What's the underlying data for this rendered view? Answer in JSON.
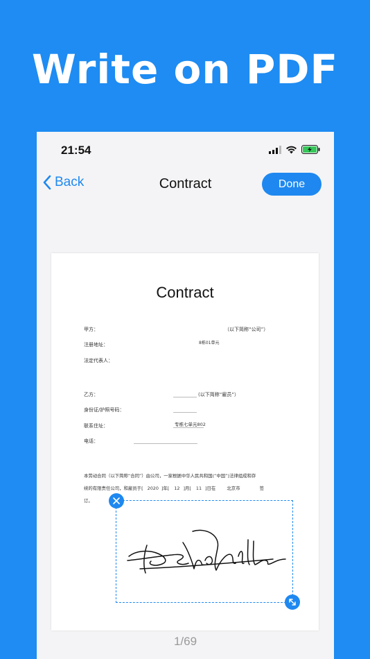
{
  "headline": "Write on PDF",
  "status": {
    "time": "21:54"
  },
  "nav": {
    "back_label": "Back",
    "title": "Contract",
    "done_label": "Done"
  },
  "document": {
    "title": "Contract",
    "party_a_label": "甲方：",
    "party_a_note": "（以下简称“公司”）",
    "registered_address_label": "注册地址：",
    "registered_address_value": "8栋01单元",
    "legal_rep_label": "法定代表人：",
    "party_b_label": "乙方：",
    "party_b_note": "(以下简称“雇员”）",
    "id_label": "身份证/护照号码：",
    "contact_address_label": "联系住址：",
    "contact_address_value": "专栋七单元802",
    "phone_label": "电话：",
    "para_line1": "本劳动合同（以下简称“合同”）由公司，一家根据中华人民共和国(“中国”)法律组成和存",
    "para_line2_a": "续的有限责任公司，和雇员于[",
    "para_year": "2020",
    "para_year_suffix": "]年[",
    "para_month": "12",
    "para_month_suffix": "]月[",
    "para_day": "11",
    "para_day_suffix": "]日在",
    "para_city": "北京市",
    "para_signed": "签",
    "para_line3": "订。"
  },
  "page_indicator": "1/69",
  "colors": {
    "accent": "#1e88f0",
    "background": "#1e8cf2"
  }
}
